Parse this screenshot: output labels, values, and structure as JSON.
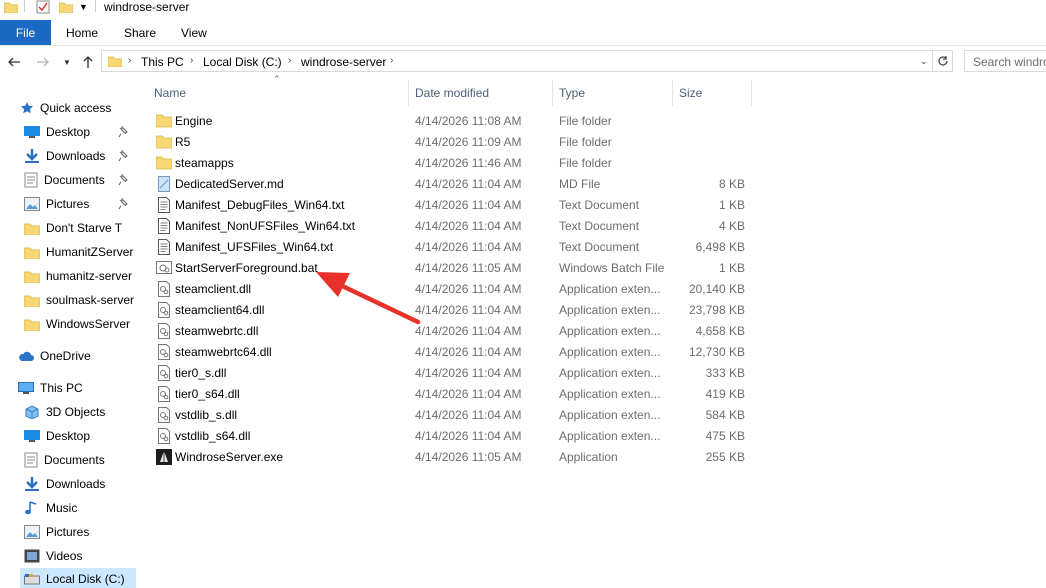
{
  "window": {
    "title": "windrose-server"
  },
  "ribbon": {
    "file": "File",
    "home": "Home",
    "share": "Share",
    "view": "View"
  },
  "address": {
    "crumbs": [
      "This PC",
      "Local Disk (C:)",
      "windrose-server"
    ],
    "search_placeholder": "Search windro"
  },
  "navpane": {
    "quick_access": "Quick access",
    "quick_items": [
      "Desktop",
      "Downloads",
      "Documents",
      "Pictures",
      "Don't Starve T",
      "HumanitZServer",
      "humanitz-server",
      "soulmask-server",
      "WindowsServer"
    ],
    "onedrive": "OneDrive",
    "this_pc": "This PC",
    "pc_items": [
      "3D Objects",
      "Desktop",
      "Documents",
      "Downloads",
      "Music",
      "Pictures",
      "Videos",
      "Local Disk (C:)"
    ]
  },
  "columns": {
    "name": "Name",
    "date": "Date modified",
    "type": "Type",
    "size": "Size"
  },
  "files": [
    {
      "name": "Engine",
      "date": "4/14/2026 11:08 AM",
      "type": "File folder",
      "size": "",
      "icon": "folder-icon"
    },
    {
      "name": "R5",
      "date": "4/14/2026 11:09 AM",
      "type": "File folder",
      "size": "",
      "icon": "folder-icon"
    },
    {
      "name": "steamapps",
      "date": "4/14/2026 11:46 AM",
      "type": "File folder",
      "size": "",
      "icon": "folder-icon"
    },
    {
      "name": "DedicatedServer.md",
      "date": "4/14/2026 11:04 AM",
      "type": "MD File",
      "size": "8 KB",
      "icon": "md-file-icon"
    },
    {
      "name": "Manifest_DebugFiles_Win64.txt",
      "date": "4/14/2026 11:04 AM",
      "type": "Text Document",
      "size": "1 KB",
      "icon": "text-file-icon"
    },
    {
      "name": "Manifest_NonUFSFiles_Win64.txt",
      "date": "4/14/2026 11:04 AM",
      "type": "Text Document",
      "size": "4 KB",
      "icon": "text-file-icon"
    },
    {
      "name": "Manifest_UFSFiles_Win64.txt",
      "date": "4/14/2026 11:04 AM",
      "type": "Text Document",
      "size": "6,498 KB",
      "icon": "text-file-icon"
    },
    {
      "name": "StartServerForeground.bat",
      "date": "4/14/2026 11:05 AM",
      "type": "Windows Batch File",
      "size": "1 KB",
      "icon": "batch-file-icon"
    },
    {
      "name": "steamclient.dll",
      "date": "4/14/2026 11:04 AM",
      "type": "Application exten...",
      "size": "20,140 KB",
      "icon": "dll-file-icon"
    },
    {
      "name": "steamclient64.dll",
      "date": "4/14/2026 11:04 AM",
      "type": "Application exten...",
      "size": "23,798 KB",
      "icon": "dll-file-icon"
    },
    {
      "name": "steamwebrtc.dll",
      "date": "4/14/2026 11:04 AM",
      "type": "Application exten...",
      "size": "4,658 KB",
      "icon": "dll-file-icon"
    },
    {
      "name": "steamwebrtc64.dll",
      "date": "4/14/2026 11:04 AM",
      "type": "Application exten...",
      "size": "12,730 KB",
      "icon": "dll-file-icon"
    },
    {
      "name": "tier0_s.dll",
      "date": "4/14/2026 11:04 AM",
      "type": "Application exten...",
      "size": "333 KB",
      "icon": "dll-file-icon"
    },
    {
      "name": "tier0_s64.dll",
      "date": "4/14/2026 11:04 AM",
      "type": "Application exten...",
      "size": "419 KB",
      "icon": "dll-file-icon"
    },
    {
      "name": "vstdlib_s.dll",
      "date": "4/14/2026 11:04 AM",
      "type": "Application exten...",
      "size": "584 KB",
      "icon": "dll-file-icon"
    },
    {
      "name": "vstdlib_s64.dll",
      "date": "4/14/2026 11:04 AM",
      "type": "Application exten...",
      "size": "475 KB",
      "icon": "dll-file-icon"
    },
    {
      "name": "WindroseServer.exe",
      "date": "4/14/2026 11:05 AM",
      "type": "Application",
      "size": "255 KB",
      "icon": "exe-file-icon"
    }
  ],
  "colors": {
    "accent": "#1a6ac4",
    "selection": "#cce8ff",
    "folder": "#f8d775",
    "annotation_arrow": "#e8312b"
  }
}
